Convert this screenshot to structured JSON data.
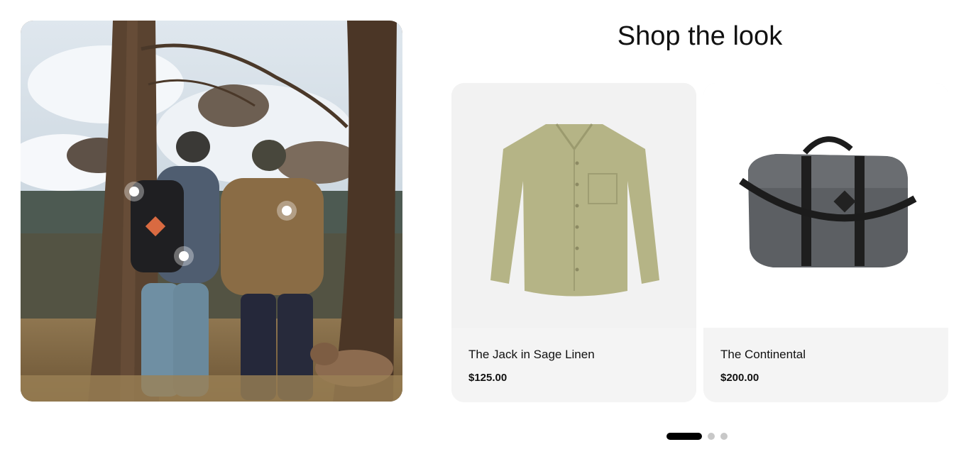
{
  "section": {
    "title": "Shop the look"
  },
  "products": [
    {
      "name": "The Jack in Sage Linen",
      "price": "$125.00",
      "image_icon": "sage-shirt-image"
    },
    {
      "name": "The Continental",
      "price": "$200.00",
      "image_icon": "grey-duffel-bag-image"
    }
  ],
  "carousel": {
    "active_index": 0,
    "page_count": 3
  },
  "colors": {
    "shirt": "#b5b486",
    "bag": "#5c5f63",
    "active_dot": "#000000",
    "inactive_dot": "#c8c8c8"
  }
}
